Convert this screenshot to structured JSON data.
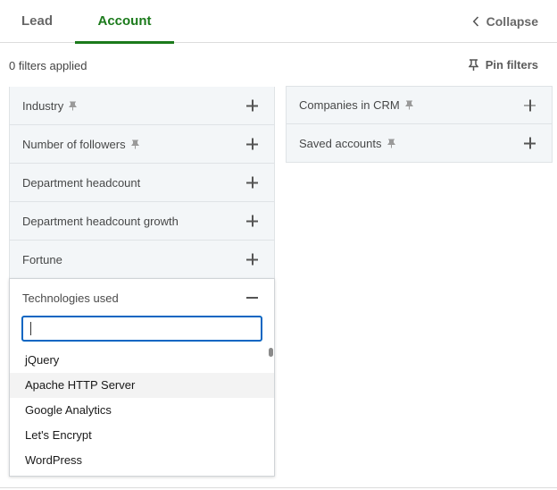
{
  "tabs": [
    {
      "label": "Lead",
      "active": false
    },
    {
      "label": "Account",
      "active": true
    }
  ],
  "collapse_label": "Collapse",
  "filters_applied": "0 filters applied",
  "pin_filters_label": "Pin filters",
  "left_filters": [
    {
      "label": "Industry",
      "pinned_icon": true
    },
    {
      "label": "Number of followers",
      "pinned_icon": true
    },
    {
      "label": "Department headcount",
      "pinned_icon": false
    },
    {
      "label": "Department headcount growth",
      "pinned_icon": false
    },
    {
      "label": "Fortune",
      "pinned_icon": false
    }
  ],
  "right_filters": [
    {
      "label": "Companies in CRM",
      "pinned_icon": true
    },
    {
      "label": "Saved accounts",
      "pinned_icon": true
    }
  ],
  "expanded_filter": {
    "label": "Technologies used",
    "search_value": "",
    "options": [
      "jQuery",
      "Apache HTTP Server",
      "Google Analytics",
      "Let's Encrypt",
      "WordPress"
    ],
    "hovered_option": "Apache HTTP Server"
  },
  "colors": {
    "accent": "#1b7a1b",
    "focus": "#0a66c2",
    "row_bg": "#f3f6f8"
  }
}
